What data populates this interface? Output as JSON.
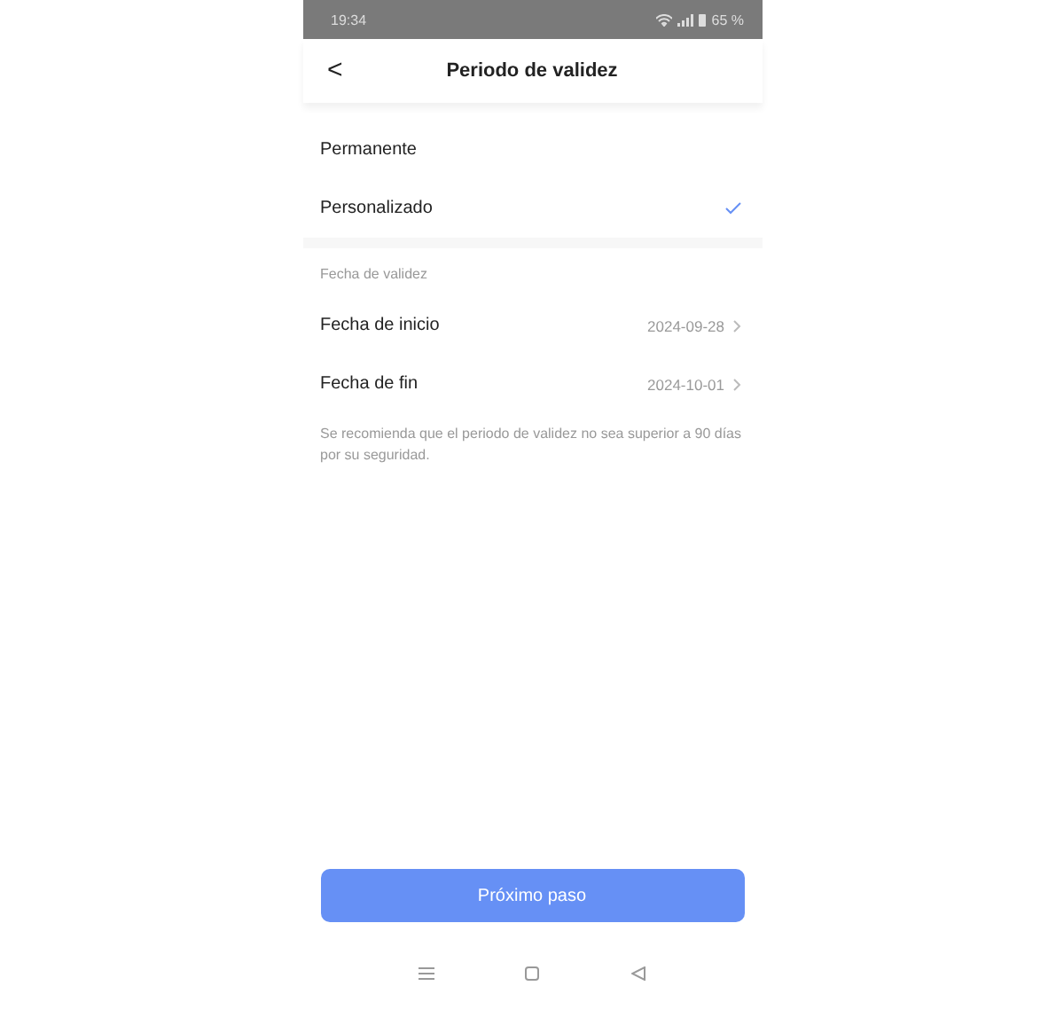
{
  "status_bar": {
    "time": "19:34",
    "battery": "65 %"
  },
  "header": {
    "back": "<",
    "title": "Periodo de validez"
  },
  "options": [
    {
      "label": "Permanente",
      "selected": false
    },
    {
      "label": "Personalizado",
      "selected": true
    }
  ],
  "section": {
    "title": "Fecha de validez",
    "rows": [
      {
        "label": "Fecha de inicio",
        "value": "2024-09-28"
      },
      {
        "label": "Fecha de fin",
        "value": "2024-10-01"
      }
    ]
  },
  "note": "Se recomienda que el periodo de validez no sea superior a 90 días por su seguridad.",
  "button": "Próximo paso"
}
